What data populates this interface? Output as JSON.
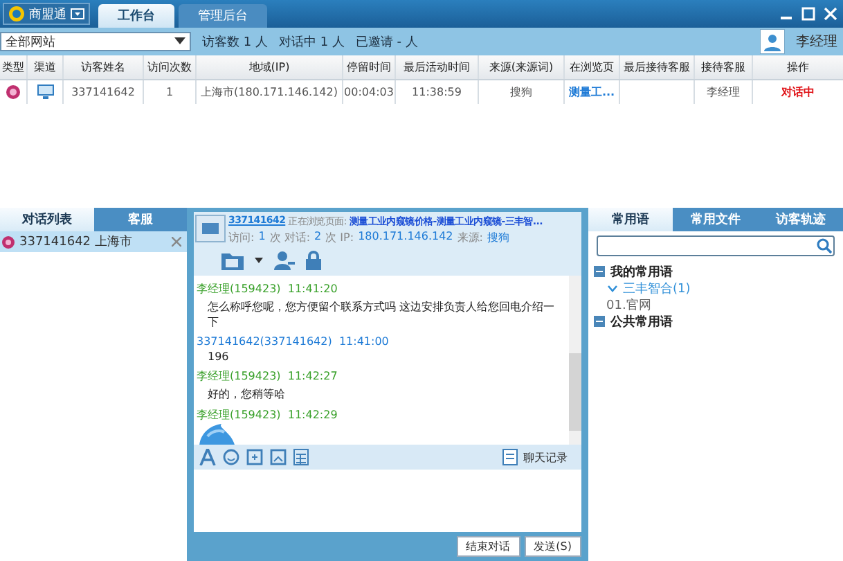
{
  "app": {
    "name": "商盟通"
  },
  "top_tabs": [
    {
      "label": "工作台",
      "selected": true
    },
    {
      "label": "管理后台",
      "selected": false
    }
  ],
  "toolbar": {
    "site_select": "全部网站",
    "stats": [
      "访客数 1 人",
      "对话中 1 人",
      "已邀请 - 人"
    ],
    "user": "李经理"
  },
  "table": {
    "columns": [
      "类型",
      "渠道",
      "访客姓名",
      "访问次数",
      "地域(IP)",
      "停留时间",
      "最后活动时间",
      "来源(来源词)",
      "在浏览页",
      "最后接待客服",
      "接待客服",
      "操作"
    ],
    "rows": [
      {
        "cells": [
          "",
          "",
          "337141642",
          "1",
          "上海市(180.171.146.142)",
          "00:04:03",
          "11:38:59",
          "搜狗",
          "测量工...",
          "",
          "李经理",
          "对话中"
        ]
      }
    ]
  },
  "conversation_tabs": [
    {
      "label": "对话列表",
      "selected": true
    },
    {
      "label": "客服",
      "selected": false
    }
  ],
  "conversations": [
    {
      "name": "337141642 上海市",
      "selected": true
    }
  ],
  "chat": {
    "visitor": "337141642",
    "browsing_label": "正在浏览页面:",
    "page": "测量工业内窥镜价格-测量工业内窥镜-三丰智...",
    "info": [
      {
        "kind": "label",
        "text": "访问:"
      },
      {
        "kind": "value",
        "text": "1"
      },
      {
        "kind": "label",
        "text": "次 对话:"
      },
      {
        "kind": "value",
        "text": "2"
      },
      {
        "kind": "label",
        "text": "次 IP:"
      },
      {
        "kind": "value",
        "text": "180.171.146.142"
      },
      {
        "kind": "label",
        "text": "来源:"
      },
      {
        "kind": "value",
        "text": "搜狗"
      }
    ],
    "messages": [
      {
        "kind": "agent",
        "sender": "李经理(159423)",
        "time": "11:41:20",
        "text": "怎么称呼您呢，您方便留个联系方式吗 这边安排负责人给您回电介绍一下"
      },
      {
        "kind": "visitor",
        "sender": "337141642(337141642)",
        "time": "11:41:00",
        "text": "196"
      },
      {
        "kind": "agent",
        "sender": "李经理(159423)",
        "time": "11:42:27",
        "text": "好的，您稍等哈"
      },
      {
        "kind": "sticker",
        "sender": "李经理(159423)",
        "time": "11:42:29"
      }
    ],
    "history_label": "聊天记录",
    "buttons": [
      "结束对话",
      "发送(S)"
    ]
  },
  "side_tabs": [
    {
      "label": "常用语",
      "selected": true
    },
    {
      "label": "常用文件",
      "selected": false
    },
    {
      "label": "访客轨迹",
      "selected": false
    }
  ],
  "phrases": [
    {
      "label": "我的常用语",
      "expanded": true,
      "children": [
        {
          "label": "三丰智合(1)",
          "expanded": true,
          "children": [
            {
              "label": "01.官网"
            }
          ]
        }
      ]
    },
    {
      "label": "公共常用语",
      "expanded": true
    }
  ]
}
